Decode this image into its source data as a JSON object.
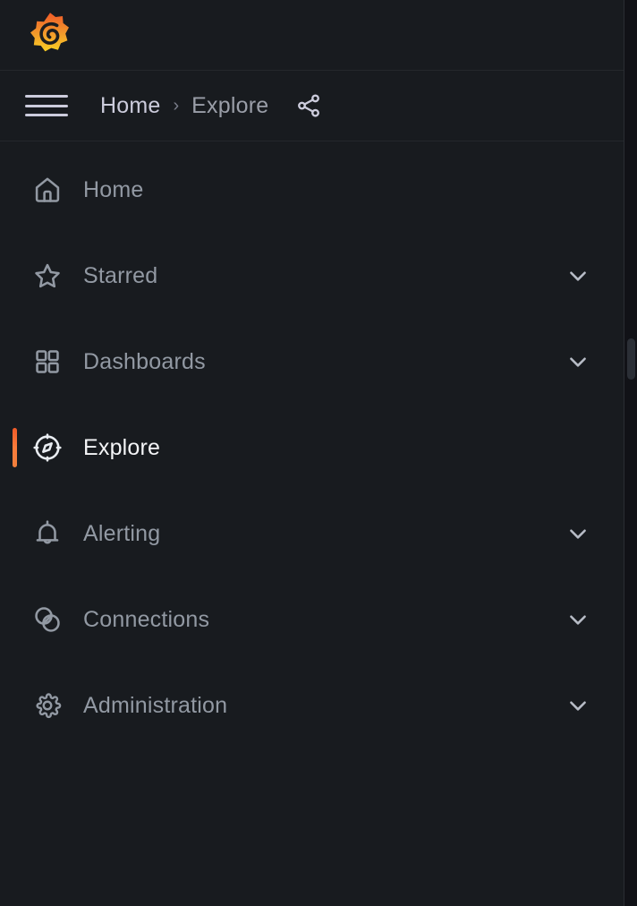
{
  "app": {
    "brand_logo": "grafana-logo",
    "background_color": "#181b1f",
    "accent_color": "#f05a28"
  },
  "topbar": {
    "menu_toggle": "hamburger-menu-icon",
    "share_label": "share-icon",
    "breadcrumb": {
      "home_label": "Home",
      "separator": "›",
      "current_label": "Explore"
    }
  },
  "nav": {
    "items": [
      {
        "label": "Home",
        "icon": "home-icon",
        "expandable": false,
        "active": false
      },
      {
        "label": "Starred",
        "icon": "star-icon",
        "expandable": true,
        "active": false
      },
      {
        "label": "Dashboards",
        "icon": "dashboards-grid-icon",
        "expandable": true,
        "active": false
      },
      {
        "label": "Explore",
        "icon": "compass-icon",
        "expandable": false,
        "active": true
      },
      {
        "label": "Alerting",
        "icon": "bell-icon",
        "expandable": true,
        "active": false
      },
      {
        "label": "Connections",
        "icon": "connections-icon",
        "expandable": true,
        "active": false
      },
      {
        "label": "Administration",
        "icon": "gear-icon",
        "expandable": true,
        "active": false
      }
    ]
  }
}
